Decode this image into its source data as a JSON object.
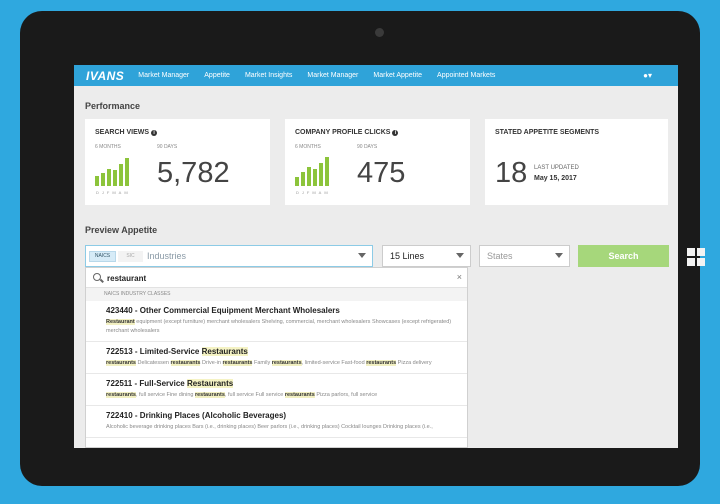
{
  "navbar": {
    "logo": "IVANS",
    "items": [
      "Market Manager",
      "Appetite",
      "Market Insights",
      "Market Manager",
      "Market Appetite",
      "Appointed Markets"
    ],
    "user_icon": "user-icon"
  },
  "performance": {
    "title": "Performance",
    "cards": [
      {
        "title": "SEARCH VIEWS",
        "sub_left": "6 MONTHS",
        "sub_right": "90 DAYS",
        "months": "DJFMAM",
        "value": "5,782",
        "bar_levels": [
          0.35,
          0.45,
          0.6,
          0.55,
          0.75,
          0.95
        ]
      },
      {
        "title": "COMPANY PROFILE CLICKS",
        "sub_left": "6 MONTHS",
        "sub_right": "90 DAYS",
        "months": "DJFMAM",
        "value": "475",
        "bar_levels": [
          0.3,
          0.5,
          0.65,
          0.6,
          0.8,
          1.0
        ]
      },
      {
        "title": "STATED APPETITE SEGMENTS",
        "value": "18",
        "updated_label": "LAST UPDATED",
        "updated_date": "May 15, 2017"
      }
    ]
  },
  "preview": {
    "title": "Preview Appetite",
    "naics_tag": "NAICS",
    "sic_tag": "SIC",
    "industry_placeholder": "Industries",
    "lines_value": "15 Lines",
    "states_placeholder": "States",
    "search_label": "Search"
  },
  "dropdown": {
    "query": "restaurant",
    "clear": "×",
    "section": "NAICS INDUSTRY CLASSES",
    "results": [
      {
        "title_pre": "423440 - Other Commercial Equipment Merchant Wholesalers",
        "title_hl": "",
        "desc": [
          [
            "Restaurant",
            true
          ],
          [
            " equipment (except furniture) merchant wholesalers Shelving, commercial, merchant wholesalers Showcases (except refrigerated) merchant wholesalers",
            false
          ]
        ]
      },
      {
        "title_pre": "722513 - Limited-Service ",
        "title_hl": "Restaurants",
        "desc": [
          [
            "restaurants",
            true
          ],
          [
            " Delicatessen ",
            false
          ],
          [
            "restaurants",
            true
          ],
          [
            " Drive-in ",
            false
          ],
          [
            "restaurants",
            true
          ],
          [
            " Family ",
            false
          ],
          [
            "restaurants",
            true
          ],
          [
            ", limited-service Fast-food ",
            false
          ],
          [
            "restaurants",
            true
          ],
          [
            " Pizza delivery",
            false
          ]
        ]
      },
      {
        "title_pre": "722511 - Full-Service ",
        "title_hl": "Restaurants",
        "desc": [
          [
            "restaurants",
            true
          ],
          [
            ", full service Fine dining ",
            false
          ],
          [
            "restaurants",
            true
          ],
          [
            ", full service Full service ",
            false
          ],
          [
            "restaurants",
            true
          ],
          [
            " Pizza parlors, full service",
            false
          ]
        ]
      },
      {
        "title_pre": "722410 - Drinking Places (Alcoholic Beverages)",
        "title_hl": "",
        "desc": [
          [
            "Alcoholic beverage drinking places Bars (i.e., drinking places) Beer parlors (i.e., drinking places) Cocktail lounges Drinking places (i.e.,",
            false
          ]
        ]
      }
    ]
  },
  "colors": {
    "nav_blue": "#2fa3d9",
    "bar_green": "#8cc43b",
    "search_green": "#a6d77b",
    "background": "#2fa8df"
  }
}
